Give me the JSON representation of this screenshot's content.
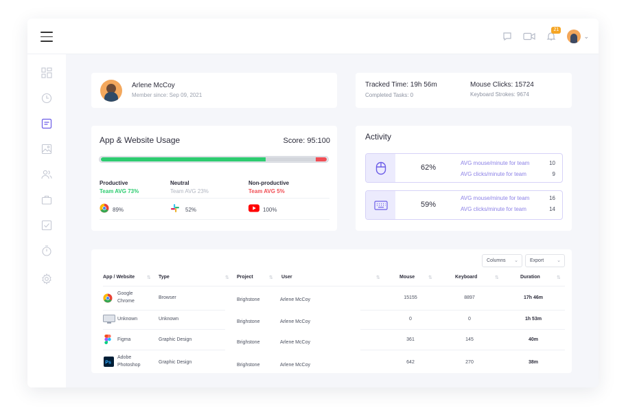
{
  "topbar": {
    "notification_count": "21",
    "icons": [
      "chat-icon",
      "video-icon",
      "bell-icon",
      "avatar",
      "chevron-down-icon"
    ]
  },
  "sidebar": {
    "items": [
      "dashboard-icon",
      "clock-icon",
      "document-icon",
      "image-icon",
      "users-icon",
      "briefcase-icon",
      "checklist-icon",
      "stopwatch-icon",
      "gear-icon"
    ],
    "active": "document-icon"
  },
  "profile": {
    "name": "Arlene McCoy",
    "member_since": "Member since: Sep 09, 2021"
  },
  "stats": {
    "tracked_time": "Tracked Time: 19h 56m",
    "completed_tasks": "Completed Tasks: 0",
    "mouse_clicks": "Mouse Clicks: 15724",
    "keyboard_strokes": "Keyboard Strokes: 9674"
  },
  "usage": {
    "title": "App & Website Usage",
    "score": "Score: 95:100",
    "bar": {
      "productive": 0.73,
      "neutral": 0.23,
      "nonproductive": 0.05
    },
    "categories": [
      {
        "label": "Productive",
        "avg": "Team AVG 73%"
      },
      {
        "label": "Neutral",
        "avg": "Team AVG 23%"
      },
      {
        "label": "Non-productive",
        "avg": "Team AVG 5%"
      }
    ],
    "apps": [
      {
        "icon": "chrome-icon",
        "pct": "89%"
      },
      {
        "icon": "slack-icon",
        "pct": "52%"
      },
      {
        "icon": "youtube-icon",
        "pct": "100%"
      }
    ]
  },
  "activity": {
    "title": "Activity",
    "rows": [
      {
        "icon": "mouse-icon",
        "pct": "62%",
        "line1": "AVG mouse/minute for team",
        "val1": "10",
        "line2": "AVG clicks/minute for team",
        "val2": "9"
      },
      {
        "icon": "keyboard-icon",
        "pct": "59%",
        "line1": "AVG mouse/minute for team",
        "val1": "16",
        "line2": "AVG clicks/minute for team",
        "val2": "14"
      }
    ]
  },
  "table": {
    "columns_button": "Columns",
    "export_button": "Export",
    "headers": [
      "App / Website",
      "Type",
      "Project",
      "User",
      "Mouse",
      "Keyboard",
      "Duration"
    ],
    "rows": [
      {
        "icon": "chrome-icon",
        "app": [
          "Google",
          "Chrome"
        ],
        "type": "Browser",
        "project": "Brighstone",
        "user": "Arlene McCoy",
        "mouse": "15155",
        "keyboard": "8897",
        "duration": "17h 46m"
      },
      {
        "icon": "monitor-icon",
        "app": [
          "Unknown"
        ],
        "type": "Unknown",
        "project": "Brighstone",
        "user": "Arlene McCoy",
        "mouse": "0",
        "keyboard": "0",
        "duration": "1h 53m"
      },
      {
        "icon": "figma-icon",
        "app": [
          "Figma"
        ],
        "type": "Graphic Design",
        "project": "Brighstone",
        "user": "Arlene McCoy",
        "mouse": "361",
        "keyboard": "145",
        "duration": "40m"
      },
      {
        "icon": "photoshop-icon",
        "app": [
          "Adobe",
          "Photoshop"
        ],
        "type": "Graphic Design",
        "project": "Brighstone",
        "user": "Arlene McCoy",
        "mouse": "642",
        "keyboard": "270",
        "duration": "38m"
      }
    ]
  },
  "colors": {
    "accent": "#6b5ce7",
    "productive": "#2dcc70",
    "nonproductive": "#f04e55",
    "badge": "#f5a524"
  }
}
